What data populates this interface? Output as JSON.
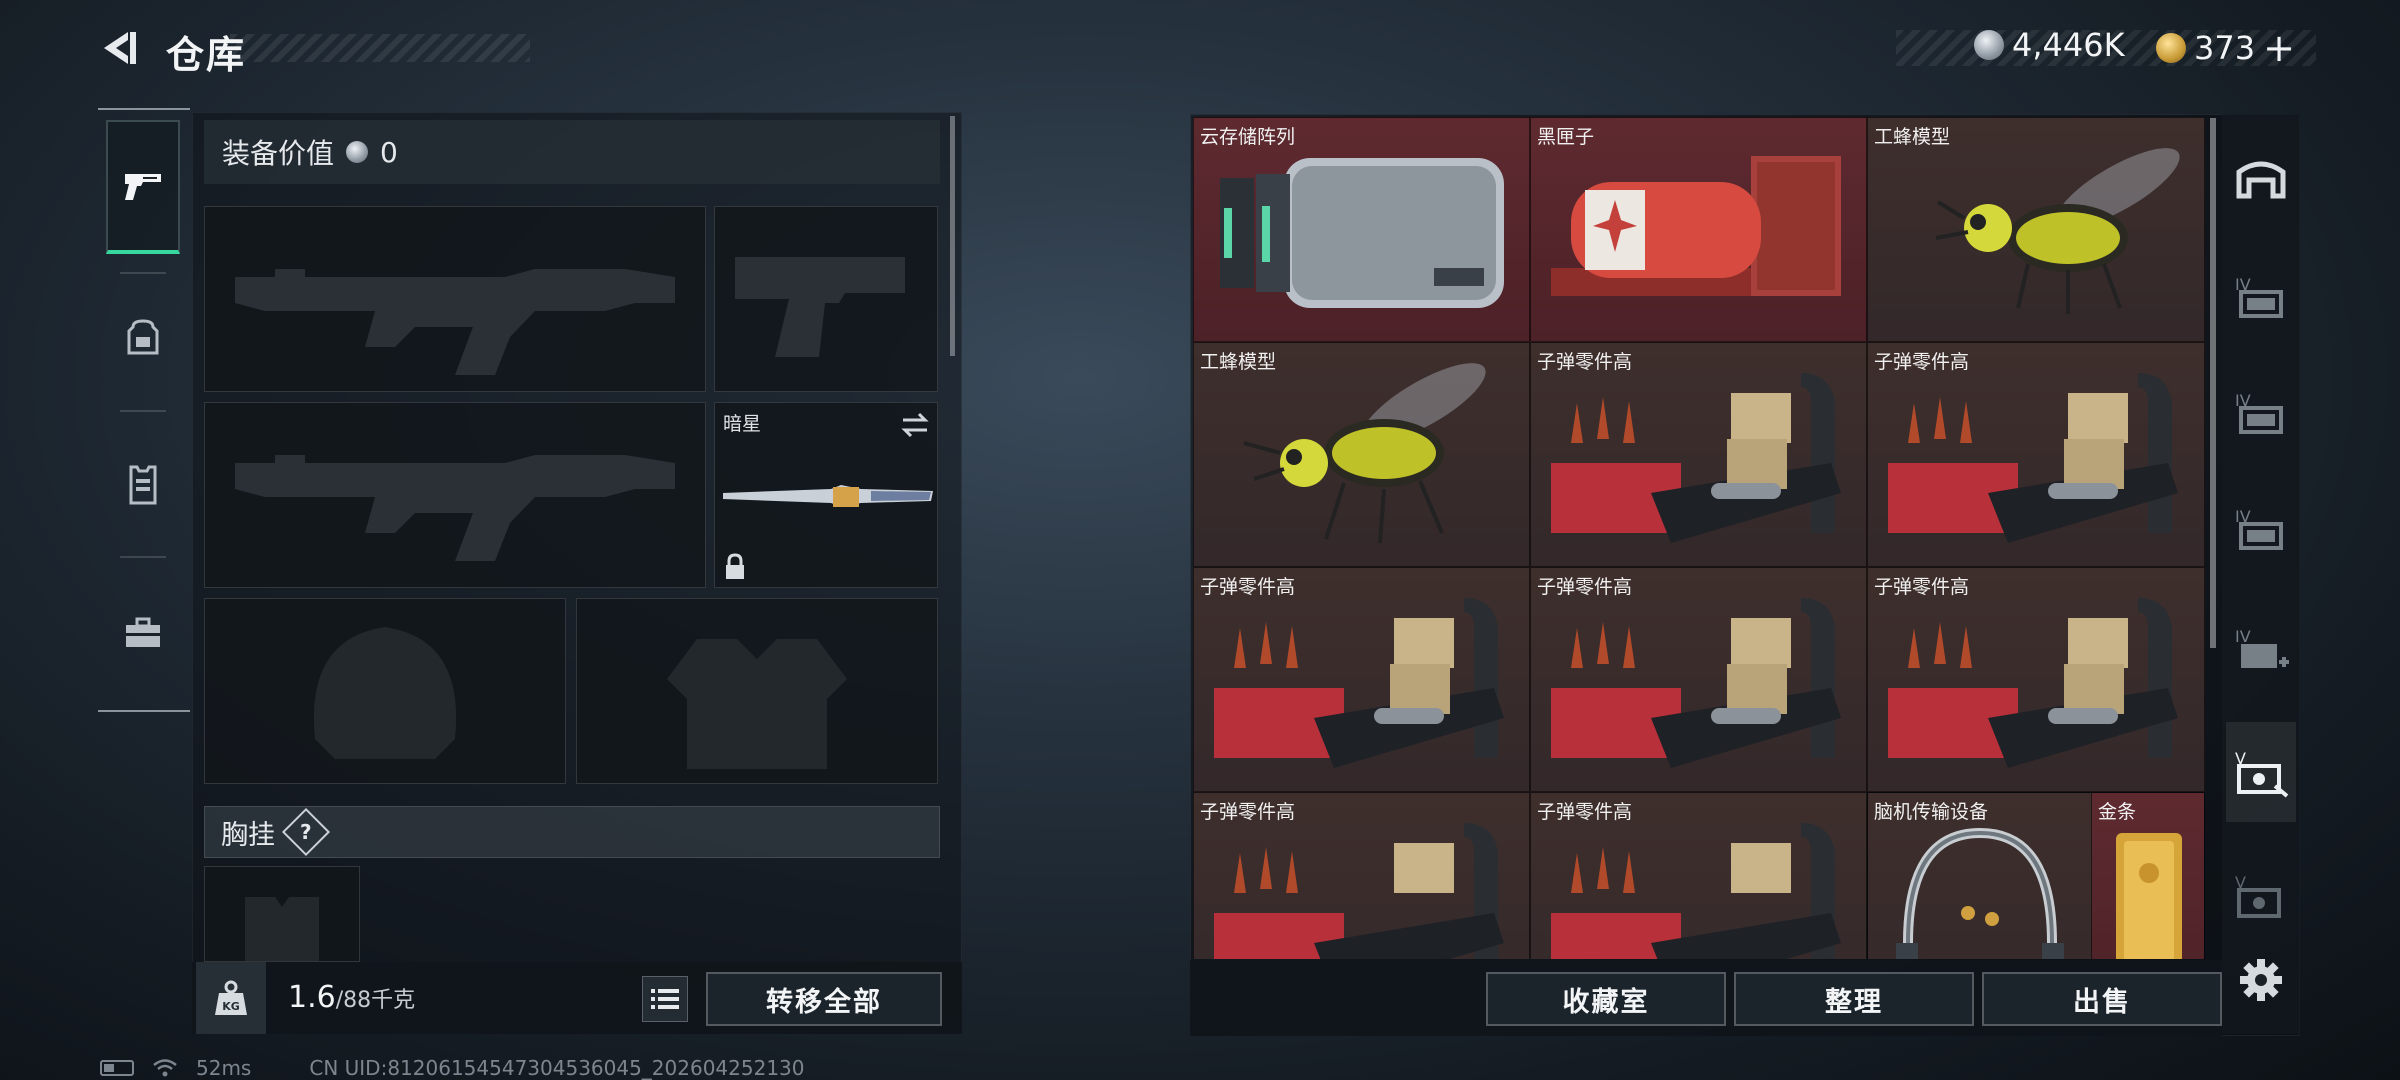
{
  "header": {
    "title": "仓库",
    "currency_silver": "4,446K",
    "currency_gold": "373",
    "currency_gold_add": "+"
  },
  "left_tabs": [
    {
      "icon": "pistol-icon",
      "active": true
    },
    {
      "icon": "backpack-icon",
      "active": false
    },
    {
      "icon": "vest-icon",
      "active": false
    },
    {
      "icon": "briefcase-icon",
      "active": false
    }
  ],
  "loadout": {
    "equip_value_label": "装备价值",
    "equip_value": "0",
    "melee_label": "暗星",
    "vest_label": "胸挂",
    "vest_badge": "?",
    "weight_current": "1.6",
    "weight_max": "/88千克",
    "transfer_all_label": "转移全部"
  },
  "stash": {
    "items": [
      {
        "name": "云存储阵列",
        "bg": "red",
        "icon": "storage-array-icon"
      },
      {
        "name": "黑匣子",
        "bg": "red",
        "icon": "black-box-icon"
      },
      {
        "name": "工蜂模型",
        "bg": "brown",
        "icon": "bee-model-icon"
      },
      {
        "name": "工蜂模型",
        "bg": "brown",
        "icon": "bee-model-icon"
      },
      {
        "name": "子弹零件高",
        "bg": "brown",
        "icon": "ammo-parts-icon"
      },
      {
        "name": "子弹零件高",
        "bg": "brown",
        "icon": "ammo-parts-icon"
      },
      {
        "name": "子弹零件高",
        "bg": "brown",
        "icon": "ammo-parts-icon"
      },
      {
        "name": "子弹零件高",
        "bg": "brown",
        "icon": "ammo-parts-icon"
      },
      {
        "name": "子弹零件高",
        "bg": "brown",
        "icon": "ammo-parts-icon"
      },
      {
        "name": "子弹零件高",
        "bg": "brown",
        "icon": "ammo-parts-icon"
      },
      {
        "name": "子弹零件高",
        "bg": "brown",
        "icon": "ammo-parts-icon"
      },
      {
        "name": "脑机传输设备",
        "bg": "brown",
        "icon": "headset-icon"
      },
      {
        "name": "金条",
        "bg": "red",
        "icon": "gold-bar-icon"
      }
    ],
    "collection_label": "收藏室",
    "sort_label": "整理",
    "sell_label": "出售"
  },
  "status_bar": {
    "ping": "52ms",
    "uid": "CN UID:81206154547304536045_202604252130"
  }
}
